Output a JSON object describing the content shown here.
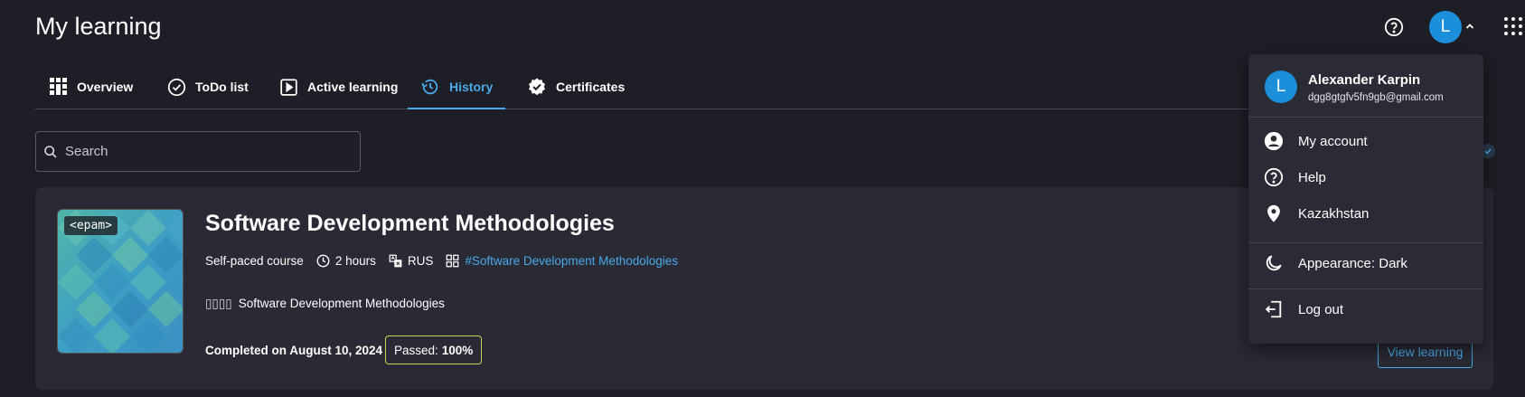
{
  "header": {
    "title": "My learning"
  },
  "user": {
    "initial": "L",
    "name": "Alexander Karpin",
    "email": "dgg8gtgfv5fn9gb@gmail.com"
  },
  "tabs": [
    {
      "label": "Overview",
      "icon": "grid-icon"
    },
    {
      "label": "ToDo list",
      "icon": "check-circle-icon"
    },
    {
      "label": "Active learning",
      "icon": "play-square-icon"
    },
    {
      "label": "History",
      "icon": "history-icon",
      "active": true
    },
    {
      "label": "Certificates",
      "icon": "certificate-badge-icon"
    }
  ],
  "search": {
    "placeholder": "Search"
  },
  "course": {
    "thumb_tag": "<epam>",
    "title": "Software Development Methodologies",
    "type": "Self-paced course",
    "duration": "2 hours",
    "language": "RUS",
    "tag_link": "#Software Development Methodologies",
    "desc_prefix": "▯▯▯▯",
    "desc_text": "Software Development Methodologies",
    "completed": "Completed on August 10, 2024",
    "passed_label": "Passed:",
    "passed_value": "100%",
    "view_button": "View learning"
  },
  "menu": {
    "items": [
      {
        "label": "My account",
        "icon": "account-circle-icon"
      },
      {
        "label": "Help",
        "icon": "help-circle-icon"
      },
      {
        "label": "Kazakhstan",
        "icon": "location-pin-icon"
      },
      {
        "label": "Appearance: Dark",
        "icon": "moon-icon"
      },
      {
        "label": "Log out",
        "icon": "logout-icon"
      }
    ]
  },
  "colors": {
    "background": "#1e1e26",
    "card": "#2a2a35",
    "accent": "#4aa9e8",
    "avatar": "#1b8fd9",
    "passed_border": "#c3d65a"
  }
}
